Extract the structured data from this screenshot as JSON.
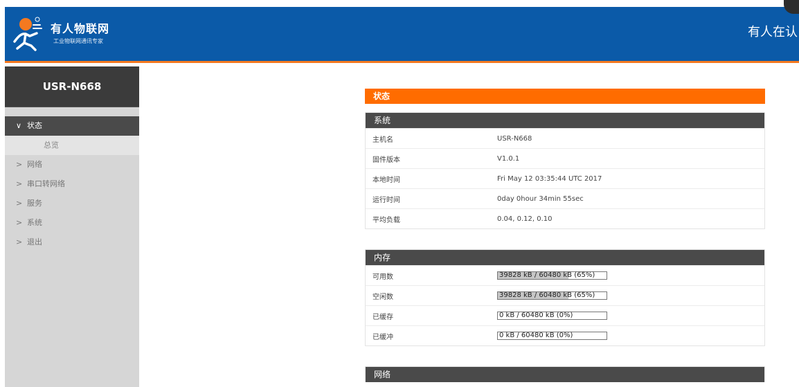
{
  "header": {
    "brand_name": "有人物联网",
    "brand_tagline": "工业物联网通讯专家",
    "right_text": "有人在认",
    "colors": {
      "header_bg": "#0b5aa8",
      "accent": "#f47920"
    }
  },
  "sidebar": {
    "device_name": "USR-N668",
    "menu": [
      {
        "label": "状态",
        "icon": "chevron-down-icon",
        "active": true
      },
      {
        "label": "网络",
        "icon": "chevron-right-icon"
      },
      {
        "label": "串口转网络",
        "icon": "chevron-right-icon"
      },
      {
        "label": "服务",
        "icon": "chevron-right-icon"
      },
      {
        "label": "系统",
        "icon": "chevron-right-icon"
      },
      {
        "label": "退出",
        "icon": "chevron-right-icon"
      }
    ],
    "submenu": [
      {
        "label": "总览",
        "selected": true
      }
    ]
  },
  "main": {
    "page_title": "状态",
    "system": {
      "title": "系统",
      "rows": [
        {
          "label": "主机名",
          "value": "USR-N668"
        },
        {
          "label": "固件版本",
          "value": "V1.0.1"
        },
        {
          "label": "本地时间",
          "value": "Fri May 12 03:35:44 UTC 2017"
        },
        {
          "label": "运行时间",
          "value": "0day 0hour 34min 55sec"
        },
        {
          "label": "平均负载",
          "value": "0.04, 0.12, 0.10"
        }
      ]
    },
    "memory": {
      "title": "内存",
      "rows": [
        {
          "label": "可用数",
          "text": "39828 kB / 60480 kB (65%)",
          "percent": 65
        },
        {
          "label": "空闲数",
          "text": "39828 kB / 60480 kB (65%)",
          "percent": 65
        },
        {
          "label": "已缓存",
          "text": "0 kB / 60480 kB (0%)",
          "percent": 0
        },
        {
          "label": "已缓冲",
          "text": "0 kB / 60480 kB (0%)",
          "percent": 0
        }
      ]
    },
    "network": {
      "title": "网络"
    }
  }
}
